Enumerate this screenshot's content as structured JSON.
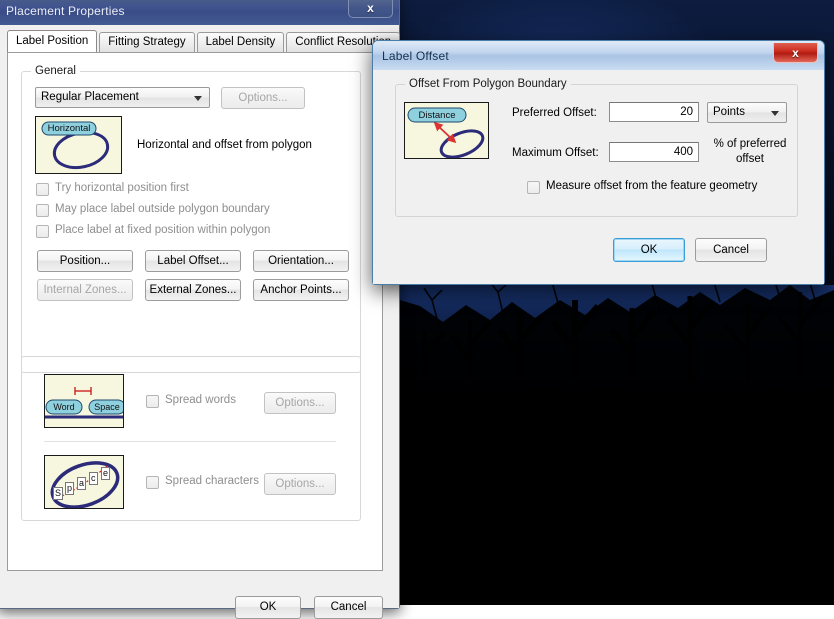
{
  "desktop": {
    "wallpaper_description": "night-forest-silhouette",
    "sky_color": "#12275c",
    "tree_color": "#000000"
  },
  "placement_properties": {
    "title": "Placement Properties",
    "close_label": "x",
    "tabs": [
      {
        "label": "Label Position",
        "selected": true
      },
      {
        "label": "Fitting Strategy",
        "selected": false
      },
      {
        "label": "Label Density",
        "selected": false
      },
      {
        "label": "Conflict Resolution",
        "selected": false
      }
    ],
    "general_group": {
      "legend": "General",
      "placement_combo": {
        "value": "Regular Placement",
        "arrow": "chevron-down-icon"
      },
      "options_button": {
        "label": "Options...",
        "enabled": false
      },
      "preview": {
        "label": "Horizontal",
        "caption": "Horizontal and offset from polygon"
      },
      "checkboxes": [
        {
          "label": "Try horizontal position first",
          "checked": false,
          "enabled": false
        },
        {
          "label": "May place label outside polygon boundary",
          "checked": false,
          "enabled": false
        },
        {
          "label": "Place label at fixed position within polygon",
          "checked": false,
          "enabled": false
        }
      ],
      "buttons": [
        {
          "label": "Position...",
          "enabled": true
        },
        {
          "label": "Label Offset...",
          "enabled": true
        },
        {
          "label": "Orientation...",
          "enabled": true
        },
        {
          "label": "Internal Zones...",
          "enabled": false
        },
        {
          "label": "External Zones...",
          "enabled": true
        },
        {
          "label": "Anchor Points...",
          "enabled": true
        }
      ]
    },
    "spread_group": {
      "words": {
        "preview_word": "Word",
        "preview_space": "Space",
        "checkbox_label": "Spread words",
        "checked": false,
        "options_button": "Options...",
        "options_enabled": false
      },
      "characters": {
        "preview_letters": [
          "S",
          "p",
          "a",
          "c",
          "e"
        ],
        "checkbox_label": "Spread characters",
        "checked": false,
        "options_button": "Options...",
        "options_enabled": false
      }
    },
    "footer": {
      "ok_label": "OK",
      "cancel_label": "Cancel"
    }
  },
  "label_offset": {
    "title": "Label Offset",
    "close_label": "x",
    "group": {
      "legend": "Offset From Polygon Boundary",
      "preview_label": "Distance",
      "preferred_offset": {
        "label": "Preferred Offset:",
        "value": "20",
        "units_combo": {
          "value": "Points",
          "arrow": "chevron-down-icon"
        }
      },
      "maximum_offset": {
        "label": "Maximum Offset:",
        "value": "400",
        "suffix_line1": "% of preferred",
        "suffix_line2": "offset"
      },
      "measure_checkbox": {
        "label": "Measure offset from the feature geometry",
        "checked": false
      }
    },
    "footer": {
      "ok_label": "OK",
      "cancel_label": "Cancel"
    }
  }
}
